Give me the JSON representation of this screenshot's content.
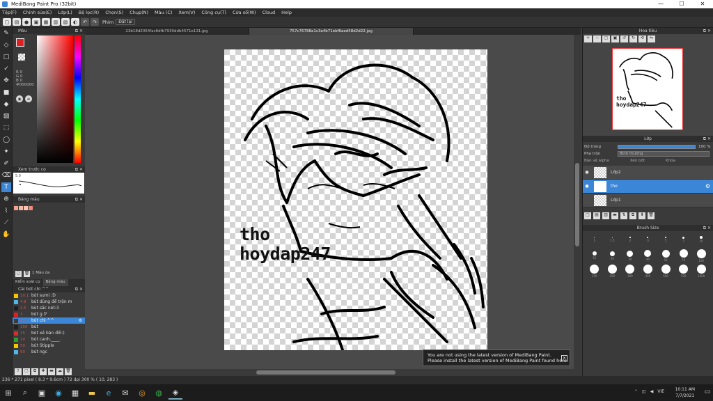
{
  "window": {
    "title": "MediBang Paint Pro (32bit)",
    "min": "—",
    "max": "☐",
    "close": "✕"
  },
  "menu": [
    "Tệp(F)",
    "Chỉnh sửa(E)",
    "Lớp(L)",
    "Bộ lọc(R)",
    "Chọn(S)",
    "Chụp(N)",
    "Màu (C)",
    "Xem(V)",
    "Công cụ(T)",
    "Cửa sổ(W)",
    "Cloud",
    "Help"
  ],
  "toolbar": {
    "phim": "Phím",
    "dat_lai": "Đặt lại"
  },
  "tabs": [
    "23b18d2054fac6dfb7930ddb4571e131.jpg",
    "757c76788a1c3a4b71ebf6aed58d2d22.jpg"
  ],
  "color_panel": {
    "title": "Màu",
    "r": "R 0",
    "g": "G 0",
    "b": "B 0",
    "hex": "#000000"
  },
  "brush_preview": {
    "title": "Xem trước cọ",
    "size": "5.0"
  },
  "palette": {
    "title": "Bảng màu",
    "mau_da": "1 Màu da",
    "swatches": [
      "#f4a38e",
      "#f7b8a4",
      "#f9c6b5",
      "#f08a7a"
    ]
  },
  "side_tabs": [
    "Kiểm soát cọ",
    "Bảng màu"
  ],
  "brush_list": {
    "title": "Cài bút chì ^^",
    "items": [
      {
        "color": "#f6c500",
        "size": "10.1",
        "name": "bút sumi :D"
      },
      {
        "color": "#4fb7e8",
        "size": "4.8",
        "name": "bút dùng để trộn m"
      },
      {
        "color": "#1f1f1f",
        "size": "2.5",
        "name": "bút sắc nét:3"
      },
      {
        "color": "#e02020",
        "size": "3",
        "name": "bút g.l?"
      },
      {
        "color": "#3b3b3b",
        "size": "0.9",
        "name": "bút chì ^^",
        "selected": true
      },
      {
        "color": "#1f1f1f",
        "size": "150",
        "name": "bút"
      },
      {
        "color": "#d03030",
        "size": "15",
        "name": "bút xẻ bàn đổi:)"
      },
      {
        "color": "#2aa02a",
        "size": "10",
        "name": "bút canh.____."
      },
      {
        "color": "#f6c500",
        "size": "50",
        "name": "bút Stipple"
      },
      {
        "color": "#4fb7e8",
        "size": "50",
        "name": "bút ngc"
      }
    ]
  },
  "navigator": {
    "title": "Hoa tiêu"
  },
  "layer_panel": {
    "title": "Lớp",
    "opacity_label": "Độ trong",
    "opacity_value": "100 %",
    "blend_label": "Pha trộn",
    "blend_value": "Bình thường",
    "checks": [
      "Bảo vệ alpha",
      "Xén bớt",
      "Khóa"
    ],
    "layers": [
      {
        "name": "Lớp2",
        "selected": false
      },
      {
        "name": "tho",
        "selected": true
      },
      {
        "name": "Lớp1",
        "selected": false
      }
    ]
  },
  "brush_size": {
    "title": "Brush Size",
    "sizes": [
      "1",
      "1.5",
      "2",
      "3",
      "5",
      "7",
      "10",
      "15",
      "20",
      "30",
      "40",
      "50",
      "70",
      "100",
      "150",
      "200",
      "300",
      "400",
      "500",
      "700",
      "1000"
    ]
  },
  "canvas": {
    "watermark_line1": "tho",
    "watermark_line2": "hoydap247"
  },
  "toast": {
    "line1": "You are not using the latest version of MediBang Paint.",
    "line2": "Please install the latest version of MediBang Paint found here."
  },
  "statusbar": {
    "text": "236 * 271 pixel   ( 8.3 * 9.6cm )   72 dpi   300 %   ( 10, 283 )"
  },
  "taskbar": {
    "time": "10:11 AM",
    "date": "7/7/2021",
    "lang": "VIE"
  }
}
